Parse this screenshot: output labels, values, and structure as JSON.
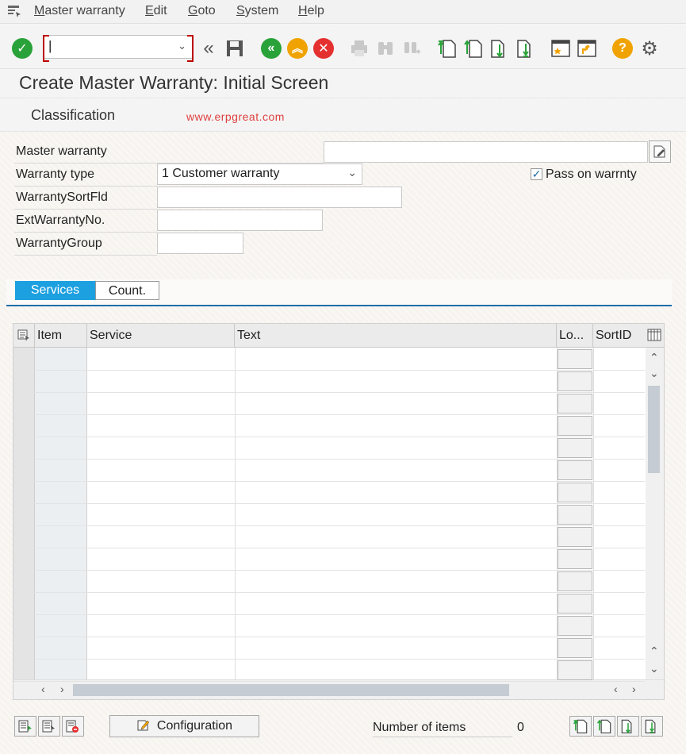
{
  "menu": {
    "items": [
      {
        "label": "Master warranty",
        "key": "M"
      },
      {
        "label": "Edit",
        "key": "E"
      },
      {
        "label": "Goto",
        "key": "G"
      },
      {
        "label": "System",
        "key": "S"
      },
      {
        "label": "Help",
        "key": "H"
      }
    ]
  },
  "toolbar": {
    "command_value": "|",
    "colors": {
      "confirm": "#2aa23a",
      "back": "#2aa23a",
      "exit": "#f0a300",
      "cancel": "#e53030",
      "help": "#f0a300"
    }
  },
  "title": "Create Master Warranty: Initial Screen",
  "classification": {
    "label": "Classification",
    "watermark": "www.erpgreat.com"
  },
  "form": {
    "master_warranty_label": "Master warranty",
    "master_warranty_value": "",
    "warranty_type_label": "Warranty type",
    "warranty_type_value": "1 Customer warranty",
    "pass_on_label": "Pass on warrnty",
    "pass_on_checked": true,
    "sort_field_label": "WarrantySortFld",
    "sort_field_value": "",
    "ext_no_label": "ExtWarrantyNo.",
    "ext_no_value": "",
    "group_label": "WarrantyGroup",
    "group_value": ""
  },
  "tabs": [
    {
      "label": "Services",
      "active": true
    },
    {
      "label": "Count.",
      "active": false
    }
  ],
  "table": {
    "columns": [
      "Item",
      "Service",
      "Text",
      "Lo...",
      "SortID"
    ],
    "rows": []
  },
  "bottom": {
    "configuration_label": "Configuration",
    "num_items_label": "Number of items",
    "num_items_value": "0"
  }
}
